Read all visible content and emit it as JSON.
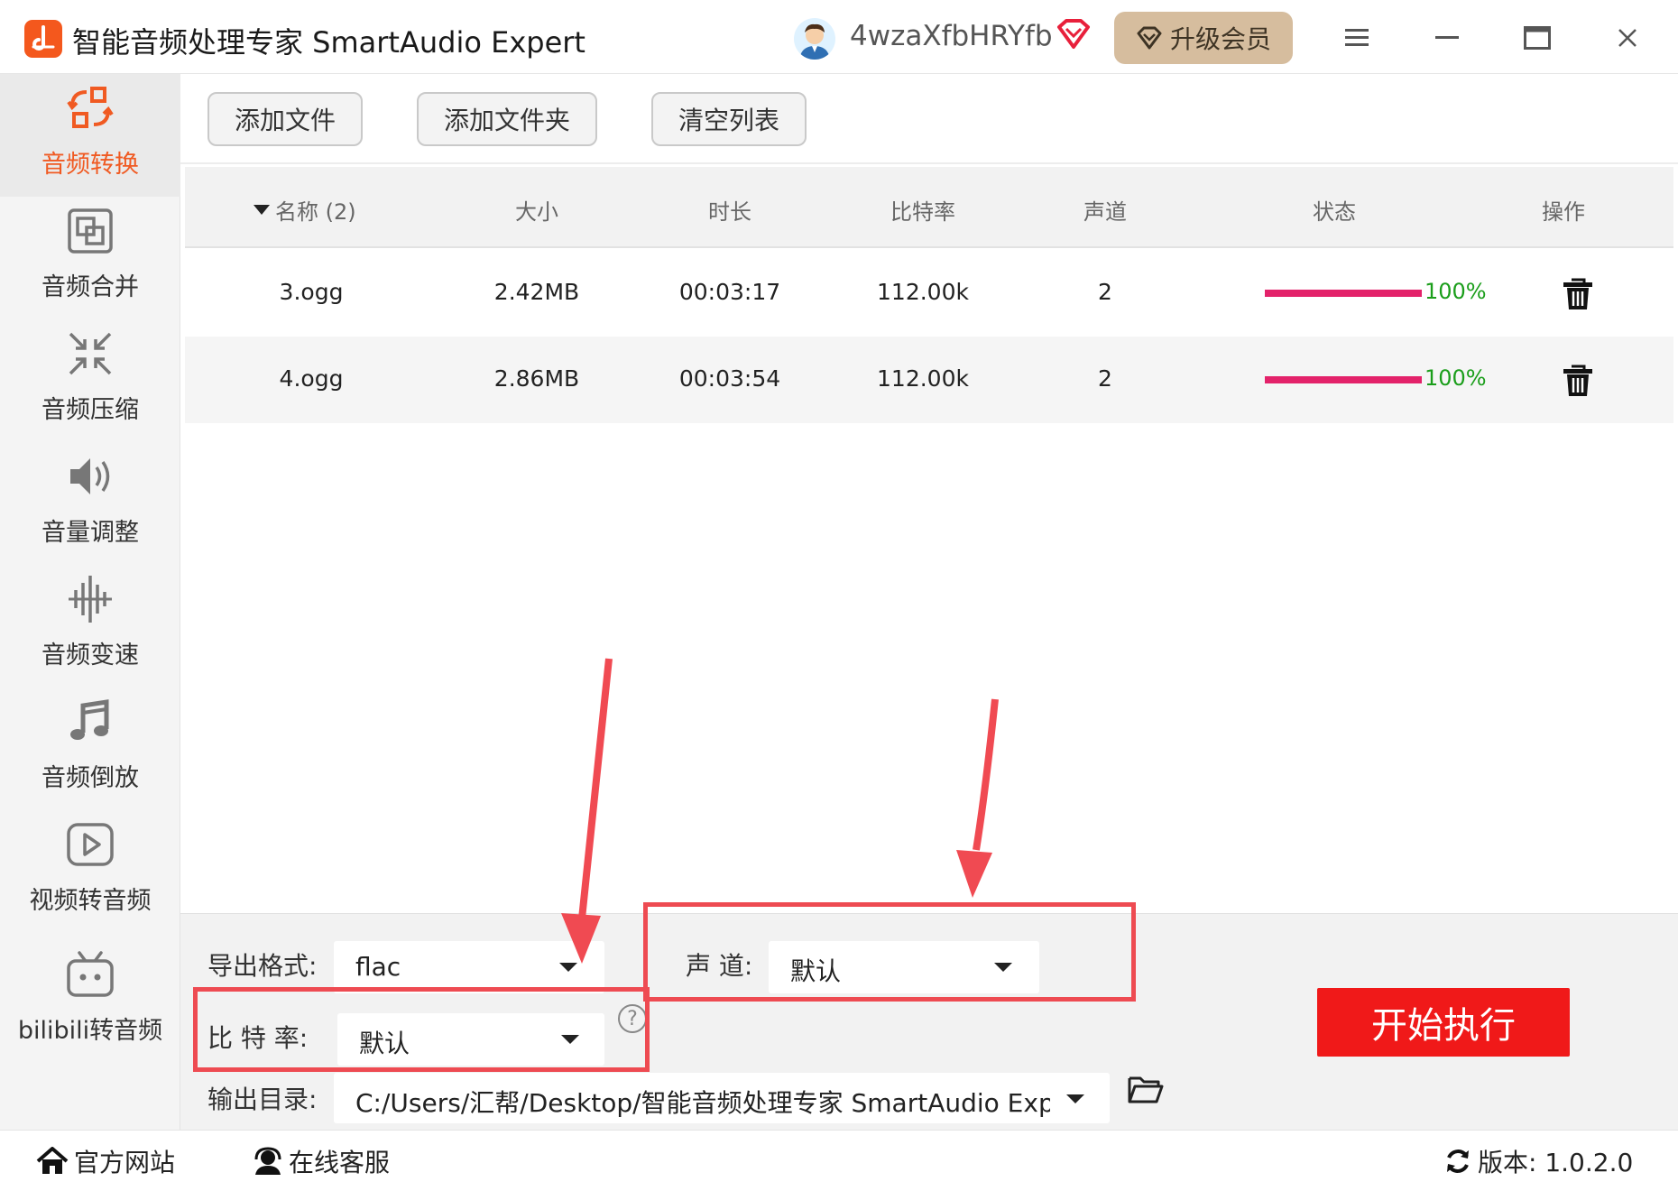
{
  "window": {
    "title": "智能音频处理专家 SmartAudio Expert",
    "username": "4wzaXfbHRYfb",
    "upgrade_label": "升级会员"
  },
  "sidebar": {
    "items": [
      {
        "label": "音频转换",
        "icon": "convert-icon",
        "active": true
      },
      {
        "label": "音频合并",
        "icon": "merge-icon"
      },
      {
        "label": "音频压缩",
        "icon": "compress-icon"
      },
      {
        "label": "音量调整",
        "icon": "volume-icon"
      },
      {
        "label": "音频变速",
        "icon": "speed-icon"
      },
      {
        "label": "音频倒放",
        "icon": "music-note-icon"
      },
      {
        "label": "视频转音频",
        "icon": "video-play-icon"
      },
      {
        "label": "bilibili转音频",
        "icon": "bilibili-tv-icon"
      }
    ]
  },
  "toolbar": {
    "add_file": "添加文件",
    "add_folder": "添加文件夹",
    "clear_list": "清空列表"
  },
  "table": {
    "headers": {
      "name": "名称 (2)",
      "size": "大小",
      "duration": "时长",
      "bitrate": "比特率",
      "channels": "声道",
      "status": "状态",
      "action": "操作"
    },
    "rows": [
      {
        "name": "3.ogg",
        "size": "2.42MB",
        "duration": "00:03:17",
        "bitrate": "112.00k",
        "channels": "2",
        "progress": 1.0,
        "progress_text": "100%"
      },
      {
        "name": "4.ogg",
        "size": "2.86MB",
        "duration": "00:03:54",
        "bitrate": "112.00k",
        "channels": "2",
        "progress": 1.0,
        "progress_text": "100%"
      }
    ]
  },
  "settings": {
    "format_label": "导出格式:",
    "format_value": "flac",
    "channel_label": "声 道:",
    "channel_value": "默认",
    "bitrate_label": "比 特 率:",
    "bitrate_value": "默认",
    "output_label": "输出目录:",
    "output_value": "C:/Users/汇帮/Desktop/智能音频处理专家 SmartAudio Exp",
    "start_label": "开始执行"
  },
  "statusbar": {
    "website": "官方网站",
    "support": "在线客服",
    "version": "版本:  1.0.2.0"
  },
  "colors": {
    "accent": "#f05a22",
    "progress": "#e3226a",
    "success": "#1b9e1b",
    "start_button": "#f01919",
    "highlight": "#ee4b52",
    "upgrade_button": "#d6bd9e"
  }
}
